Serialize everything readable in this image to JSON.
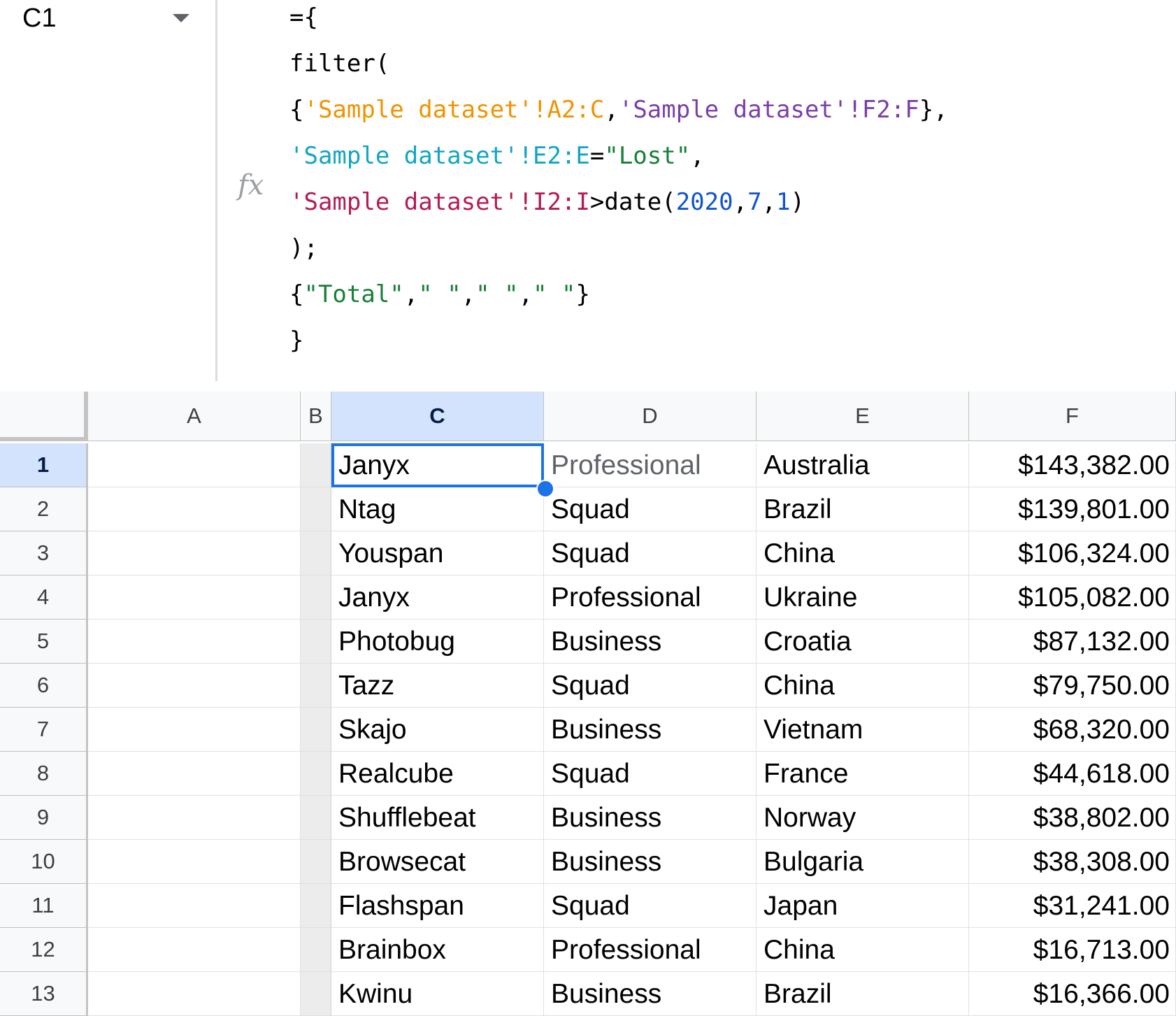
{
  "name_box": {
    "cell_ref": "C1"
  },
  "formula_bar": {
    "fx_label": "fx",
    "lines": [
      [
        {
          "t": "={",
          "c": ""
        }
      ],
      [
        {
          "t": "filter(",
          "c": ""
        }
      ],
      [
        {
          "t": "{",
          "c": ""
        },
        {
          "t": "'Sample dataset'!A2:C",
          "c": "orange"
        },
        {
          "t": ",",
          "c": ""
        },
        {
          "t": "'Sample dataset'!F2:F",
          "c": "purple"
        },
        {
          "t": "},",
          "c": ""
        }
      ],
      [
        {
          "t": "'Sample dataset'!E2:E",
          "c": "teal"
        },
        {
          "t": "=",
          "c": ""
        },
        {
          "t": "\"Lost\"",
          "c": "green"
        },
        {
          "t": ",",
          "c": ""
        }
      ],
      [
        {
          "t": "'Sample dataset'!I2:I",
          "c": "crimson"
        },
        {
          "t": ">date(",
          "c": ""
        },
        {
          "t": "2020",
          "c": "blue"
        },
        {
          "t": ",",
          "c": ""
        },
        {
          "t": "7",
          "c": "blue"
        },
        {
          "t": ",",
          "c": ""
        },
        {
          "t": "1",
          "c": "blue"
        },
        {
          "t": ")",
          "c": ""
        }
      ],
      [
        {
          "t": ");",
          "c": ""
        }
      ],
      [
        {
          "t": "{",
          "c": ""
        },
        {
          "t": "\"Total\"",
          "c": "green"
        },
        {
          "t": ",",
          "c": ""
        },
        {
          "t": "\" \"",
          "c": "green"
        },
        {
          "t": ",",
          "c": ""
        },
        {
          "t": "\" \"",
          "c": "green"
        },
        {
          "t": ",",
          "c": ""
        },
        {
          "t": "\" \"",
          "c": "green"
        },
        {
          "t": "}",
          "c": ""
        }
      ],
      [
        {
          "t": "}",
          "c": ""
        }
      ]
    ]
  },
  "colors": {
    "orange": "#f09300",
    "purple": "#7b3fa8",
    "teal": "#12a5c2",
    "crimson": "#b31b54",
    "green": "#188038",
    "blue": "#1155cc",
    "selection": "#1a73e8",
    "header_selected_bg": "#d3e3fd"
  },
  "grid": {
    "columns": [
      "A",
      "B",
      "C",
      "D",
      "E",
      "F"
    ],
    "selected_column": "C",
    "selected_row": 1,
    "selected_cell": "C1",
    "rows": [
      {
        "n": "1",
        "c": "Janyx",
        "d": "Professional",
        "e": "Australia",
        "f": "$143,382.00"
      },
      {
        "n": "2",
        "c": "Ntag",
        "d": "Squad",
        "e": "Brazil",
        "f": "$139,801.00"
      },
      {
        "n": "3",
        "c": "Youspan",
        "d": "Squad",
        "e": "China",
        "f": "$106,324.00"
      },
      {
        "n": "4",
        "c": "Janyx",
        "d": "Professional",
        "e": "Ukraine",
        "f": "$105,082.00"
      },
      {
        "n": "5",
        "c": "Photobug",
        "d": "Business",
        "e": "Croatia",
        "f": "$87,132.00"
      },
      {
        "n": "6",
        "c": "Tazz",
        "d": "Squad",
        "e": "China",
        "f": "$79,750.00"
      },
      {
        "n": "7",
        "c": "Skajo",
        "d": "Business",
        "e": "Vietnam",
        "f": "$68,320.00"
      },
      {
        "n": "8",
        "c": "Realcube",
        "d": "Squad",
        "e": "France",
        "f": "$44,618.00"
      },
      {
        "n": "9",
        "c": "Shufflebeat",
        "d": "Business",
        "e": "Norway",
        "f": "$38,802.00"
      },
      {
        "n": "10",
        "c": "Browsecat",
        "d": "Business",
        "e": "Bulgaria",
        "f": "$38,308.00"
      },
      {
        "n": "11",
        "c": "Flashspan",
        "d": "Squad",
        "e": "Japan",
        "f": "$31,241.00"
      },
      {
        "n": "12",
        "c": "Brainbox",
        "d": "Professional",
        "e": "China",
        "f": "$16,713.00"
      },
      {
        "n": "13",
        "c": "Kwinu",
        "d": "Business",
        "e": "Brazil",
        "f": "$16,366.00"
      }
    ]
  }
}
